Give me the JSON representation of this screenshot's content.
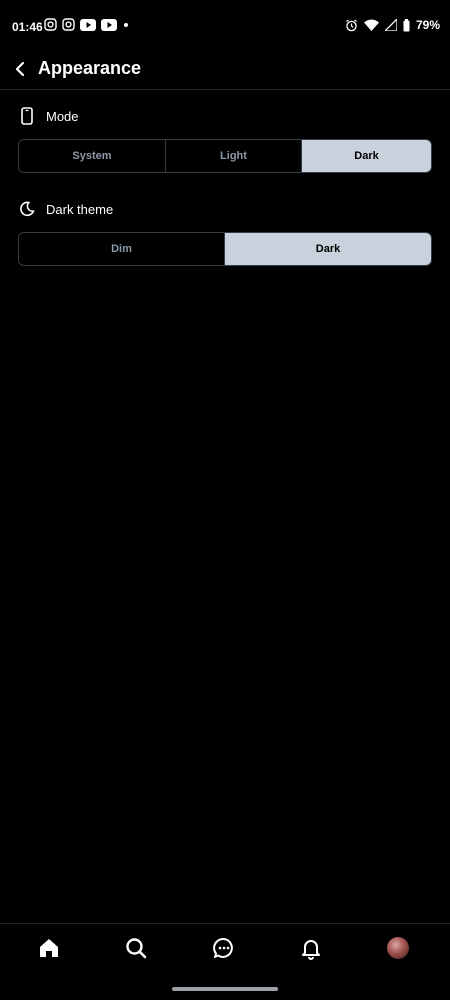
{
  "status_bar": {
    "time": "01:46",
    "battery": "79%"
  },
  "header": {
    "title": "Appearance"
  },
  "mode": {
    "label": "Mode",
    "options": [
      "System",
      "Light",
      "Dark"
    ],
    "selected": "Dark"
  },
  "dark_theme": {
    "label": "Dark theme",
    "options": [
      "Dim",
      "Dark"
    ],
    "selected": "Dark"
  },
  "colors": {
    "background": "#000000",
    "selected_segment": "#c8d1dc",
    "unselected_text": "#8b98a5",
    "border": "#333b44"
  },
  "bottom_nav": {
    "items": [
      "home-icon",
      "search-icon",
      "messages-icon",
      "notifications-icon",
      "avatar"
    ]
  }
}
